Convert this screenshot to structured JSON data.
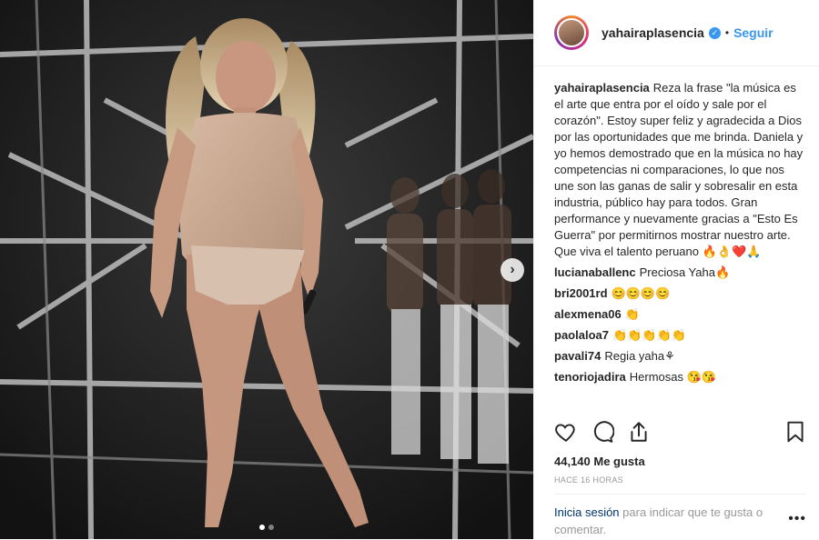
{
  "header": {
    "username": "yahairaplasencia",
    "verified_icon": "verified-badge-icon",
    "separator": "•",
    "follow_label": "Seguir"
  },
  "caption": {
    "username": "yahairaplasencia",
    "text": "Reza la frase \"la música es el arte que entra por el oído y sale por el corazón\". Estoy super feliz y agradecida a Dios por las oportunidades que me brinda. Daniela y yo hemos demostrado que en la música no hay competencias ni comparaciones, lo que nos une son las ganas de salir y sobresalir en esta industria, público hay para todos. Gran performance y nuevamente gracias a \"Esto Es Guerra\" por permitirnos mostrar nuestro arte. Que viva el talento peruano 🔥👌❤️🙏"
  },
  "comments": [
    {
      "username": "lucianaballenc",
      "text": "Preciosa Yaha🔥"
    },
    {
      "username": "bri2001rd",
      "text": "😊😊😊😊"
    },
    {
      "username": "alexmena06",
      "text": "👏"
    },
    {
      "username": "paolaloa7",
      "text": "👏👏👏👏👏"
    },
    {
      "username": "pavali74",
      "text": "Regia yaha⚘"
    },
    {
      "username": "tenoriojadira",
      "text": "Hermosas 😘😘"
    }
  ],
  "actions": {
    "like_icon": "heart-icon",
    "comment_icon": "comment-icon",
    "share_icon": "share-icon",
    "save_icon": "bookmark-icon"
  },
  "likes_text": "44,140 Me gusta",
  "time_text": "HACE 16 HORAS",
  "login": {
    "link": "Inicia sesión",
    "rest": " para indicar que te gusta o comentar."
  },
  "more_icon": "•••",
  "carousel": {
    "next_icon": "›",
    "slides": 2,
    "active_slide": 1
  },
  "colors": {
    "accent": "#3897f0",
    "link_dark": "#003569",
    "muted": "#999999",
    "text": "#262626"
  }
}
